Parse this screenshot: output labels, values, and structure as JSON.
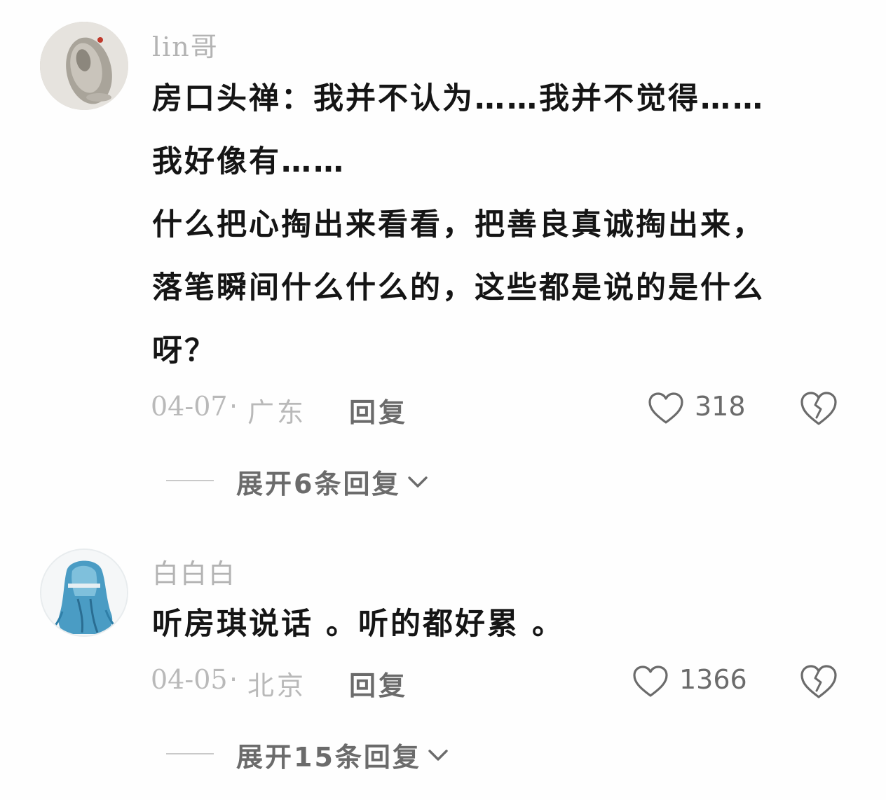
{
  "comments": [
    {
      "username": "lin哥",
      "text_lines": [
        "房口头禅：我并不认为……我并不觉得……",
        "我好像有……",
        "什么把心掏出来看看，把善良真诚掏出来，",
        "落笔瞬间什么什么的，这些都是说的是什么",
        "呀？"
      ],
      "date": "04-07",
      "separator": "·",
      "location": "广东",
      "reply_label": "回复",
      "likes": "318",
      "expand_label": "展开6条回复",
      "avatar_icon": "user-avatar-photo"
    },
    {
      "username": "白白白",
      "text_lines": [
        "听房琪说话 。听的都好累 。"
      ],
      "date": "04-05",
      "separator": "·",
      "location": "北京",
      "reply_label": "回复",
      "likes": "1366",
      "expand_label": "展开15条回复",
      "avatar_icon": "user-avatar-illustration"
    }
  ],
  "colors": {
    "text_primary": "#151515",
    "text_secondary": "#6b6b6b",
    "text_muted": "#b3b3b3",
    "background": "#fefefe"
  },
  "icons": {
    "like": "heart-outline-icon",
    "dislike": "broken-heart-icon",
    "expand": "chevron-down-icon"
  }
}
